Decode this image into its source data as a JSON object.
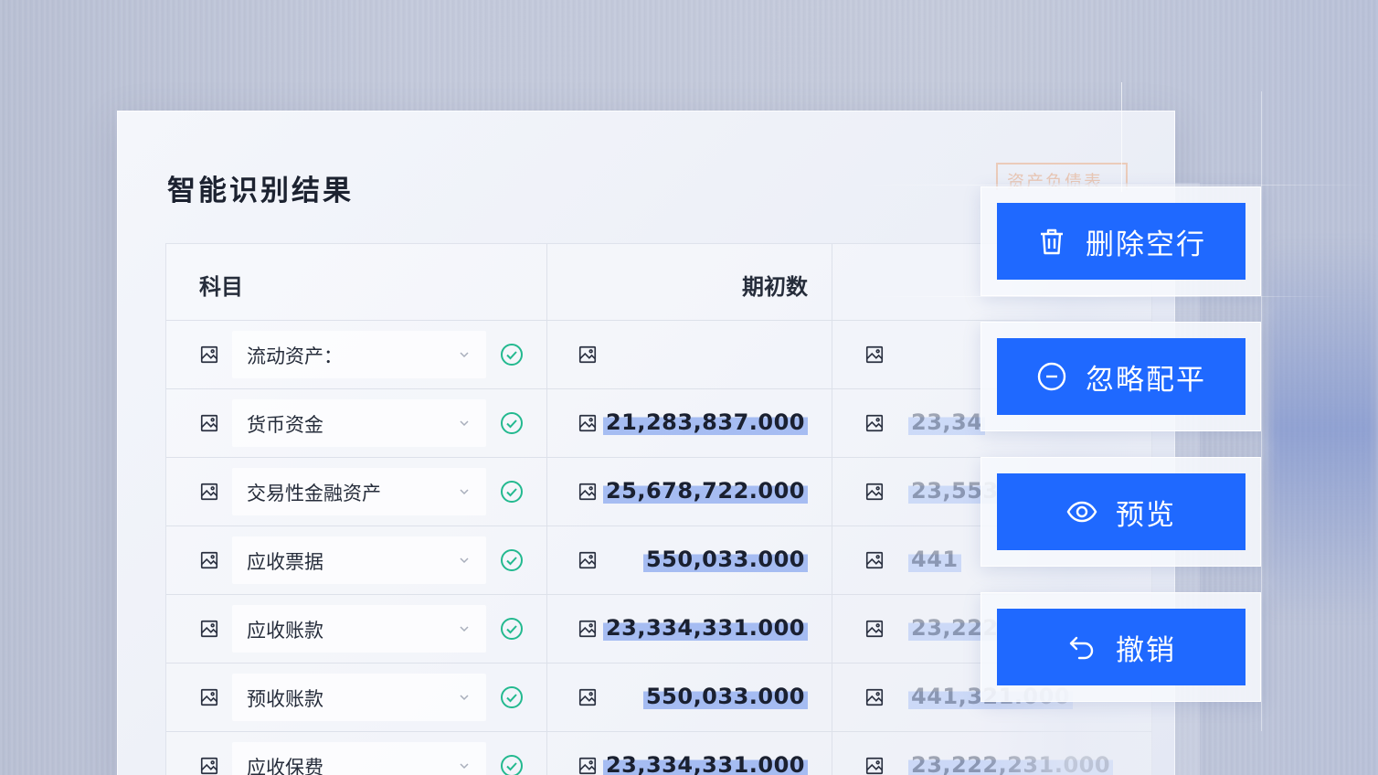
{
  "page": {
    "title": "智能识别结果",
    "ghost_tag": "资产负债表"
  },
  "table": {
    "headers": {
      "subject": "科目",
      "opening": "期初数"
    },
    "rows": [
      {
        "subject": "流动资产：",
        "opening": "",
        "ending": ""
      },
      {
        "subject": "货币资金",
        "opening": "21,283,837.000",
        "ending": "23,34"
      },
      {
        "subject": "交易性金融资产",
        "opening": "25,678,722.000",
        "ending": "23,553"
      },
      {
        "subject": "应收票据",
        "opening": "550,033.000",
        "ending": "441"
      },
      {
        "subject": "应收账款",
        "opening": "23,334,331.000",
        "ending": "23,222"
      },
      {
        "subject": "预收账款",
        "opening": "550,033.000",
        "ending": "441,321.000"
      },
      {
        "subject": "应收保费",
        "opening": "23,334,331.000",
        "ending": "23,222,231.000"
      }
    ]
  },
  "actions": [
    {
      "label": "删除空行",
      "icon": "trash-icon"
    },
    {
      "label": "忽略配平",
      "icon": "minus-circle-icon"
    },
    {
      "label": "预览",
      "icon": "eye-icon"
    },
    {
      "label": "撤销",
      "icon": "undo-icon"
    }
  ],
  "colors": {
    "primary": "#1f69ff",
    "success": "#23b98f",
    "highlight": "#8caaf0"
  }
}
